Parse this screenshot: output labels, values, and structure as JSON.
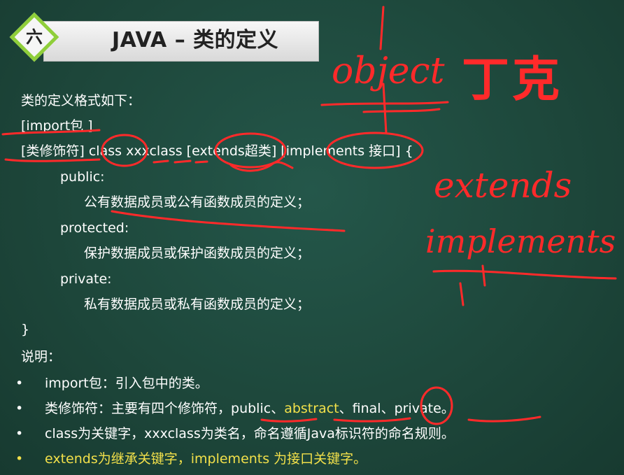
{
  "slide": {
    "section_number": "六",
    "title": "JAVA – 类的定义"
  },
  "code": {
    "intro": "类的定义格式如下：",
    "import": "[import包 ]",
    "declaration": "[类修饰符] class  xxxclass [extends超类] [implements 接口] {",
    "public_label": "public:",
    "public_desc": "公有数据成员或公有函数成员的定义；",
    "protected_label": "protected:",
    "protected_desc": "保护数据成员或保护函数成员的定义；",
    "private_label": "private:",
    "private_desc": "私有数据成员或私有函数成员的定义；",
    "close": "}"
  },
  "notes": {
    "heading": "说明：",
    "bullet_symbol": "•",
    "items": [
      {
        "text": "import包：引入包中的类。"
      },
      {
        "prefix": "类修饰符：主要有四个修饰符，",
        "public": "public",
        "sep1": "、",
        "abstract": "abstract",
        "sep2": "、",
        "final": "final",
        "sep3": "、",
        "private": "private",
        "suffix": "。"
      },
      {
        "text": "class为关键字，xxxclass为类名，命名遵循Java标识符的命名规则。"
      },
      {
        "text": "extends为继承关键字，implements 为接口关键字。"
      }
    ]
  },
  "handwriting": {
    "object": "object",
    "name": "丁克",
    "extends": "extends",
    "implements": "implements"
  },
  "colors": {
    "board": "#1f4a3d",
    "ink_red": "#ff2a2a",
    "accent_yellow": "#f2e04a",
    "badge_green": "#8fce3a"
  }
}
